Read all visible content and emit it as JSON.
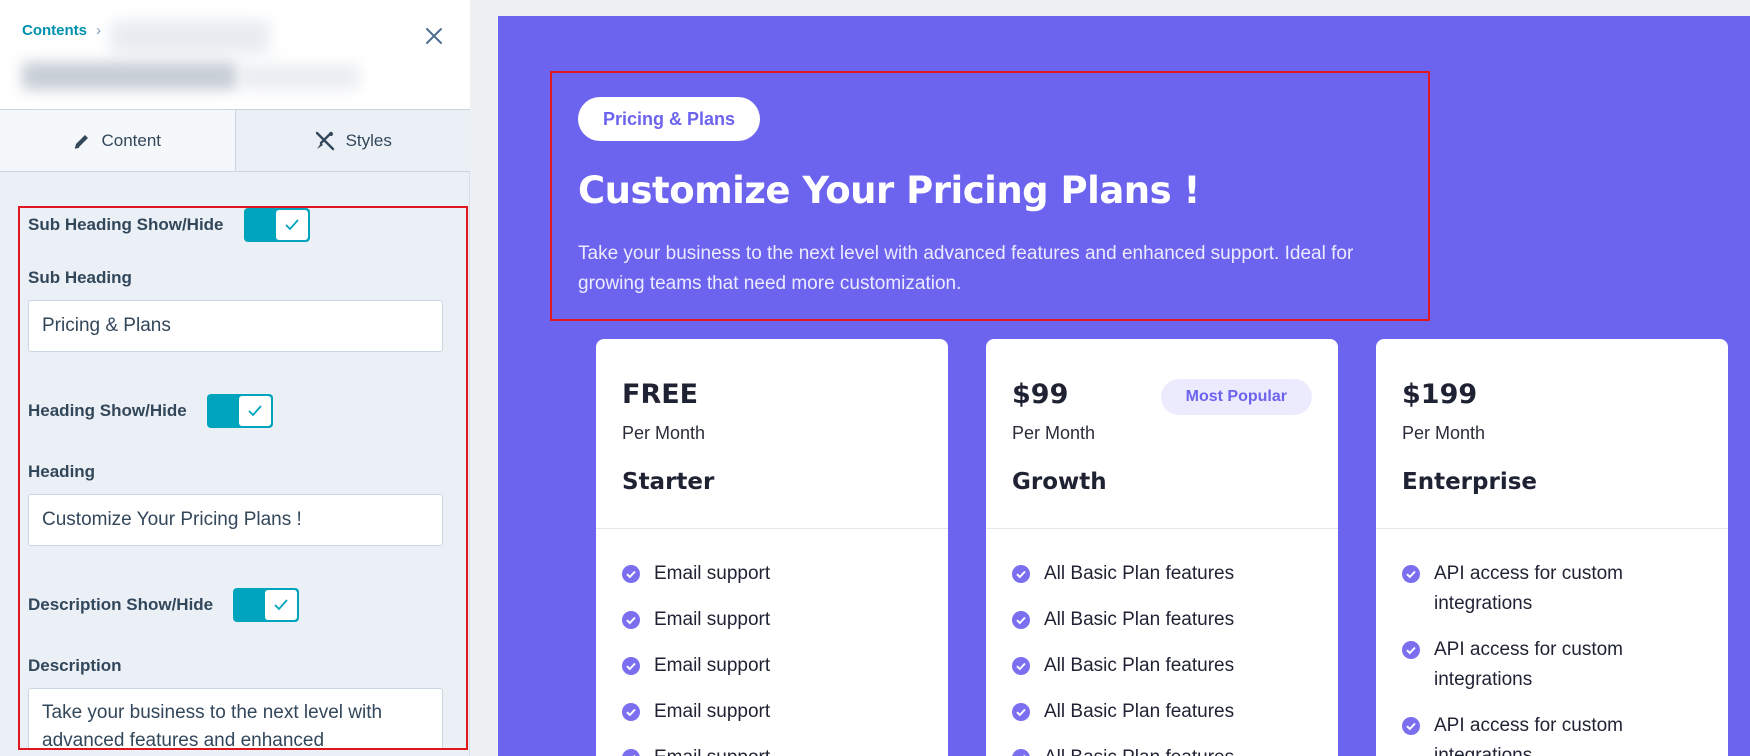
{
  "panel": {
    "breadcrumb": "Contents",
    "breadcrumb_sep": "›",
    "tabs": [
      {
        "label": "Content",
        "icon": "pencil-icon",
        "active": true
      },
      {
        "label": "Styles",
        "icon": "brush-tools-icon",
        "active": false
      }
    ],
    "fields": {
      "subheading_toggle_label": "Sub Heading Show/Hide",
      "subheading_toggle_on": true,
      "subheading_label": "Sub Heading",
      "subheading_value": "Pricing & Plans",
      "heading_toggle_label": "Heading Show/Hide",
      "heading_toggle_on": true,
      "heading_label": "Heading",
      "heading_value": "Customize Your Pricing Plans !",
      "description_toggle_label": "Description Show/Hide",
      "description_toggle_on": true,
      "description_label": "Description",
      "description_value": "Take your business to the next level with advanced features and enhanced"
    }
  },
  "preview": {
    "subheading": "Pricing & Plans",
    "heading": "Customize Your Pricing Plans !",
    "description": "Take your business to the next level with advanced features and enhanced support. Ideal for growing teams that need more customization.",
    "plans": [
      {
        "price": "FREE",
        "period": "Per Month",
        "name": "Starter",
        "badge": "",
        "features": [
          "Email support",
          "Email support",
          "Email support",
          "Email support",
          "Email support"
        ]
      },
      {
        "price": "$99",
        "period": "Per Month",
        "name": "Growth",
        "badge": "Most Popular",
        "features": [
          "All Basic Plan features",
          "All Basic Plan features",
          "All Basic Plan features",
          "All Basic Plan features",
          "All Basic Plan features"
        ]
      },
      {
        "price": "$199",
        "period": "Per Month",
        "name": "Enterprise",
        "badge": "",
        "features": [
          "API access for custom integrations",
          "API access for custom integrations",
          "API access for custom integrations"
        ]
      }
    ]
  },
  "colors": {
    "accent_teal": "#00a4bd",
    "brand_purple": "#6c63ee",
    "highlight_red": "#e0171f"
  }
}
